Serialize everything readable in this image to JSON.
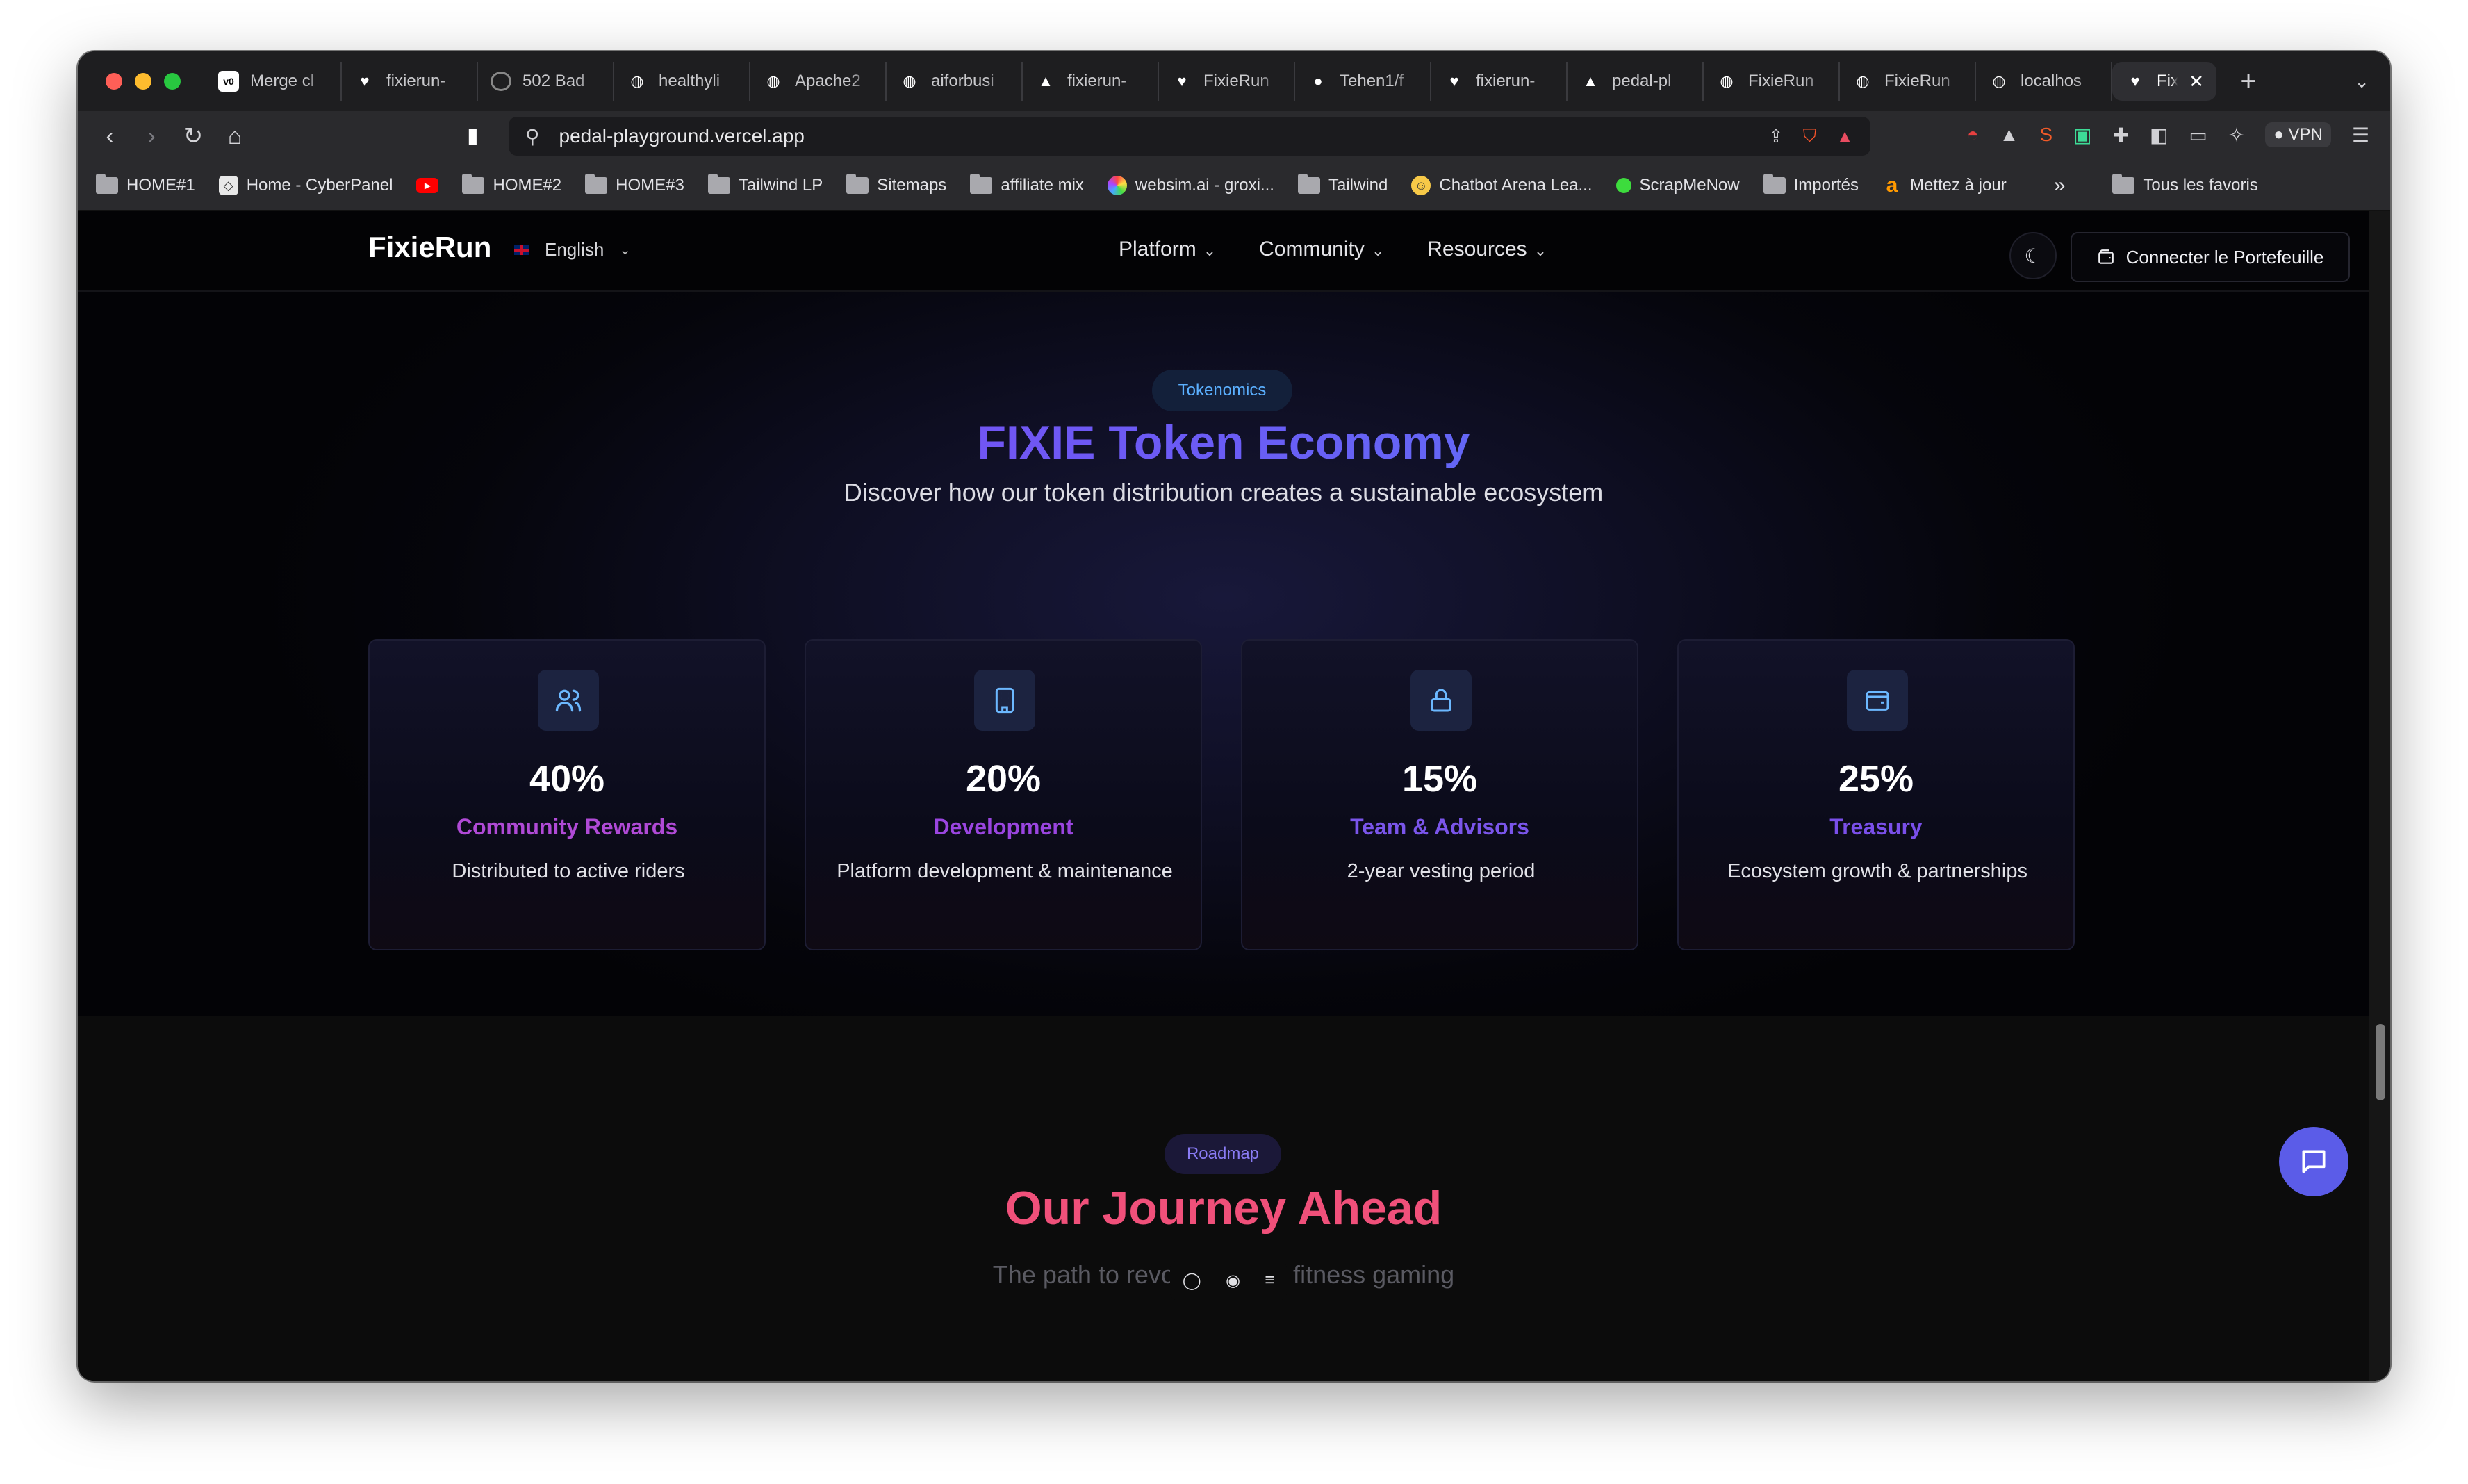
{
  "colors": {
    "traffic_close": "#ff5f57",
    "traffic_min": "#febc2e",
    "traffic_max": "#28c840",
    "accent_purple": "#8a3ff0",
    "accent_blue": "#4f8cf7",
    "road_pink": "#f0507a",
    "chat_button": "#5b5ce8"
  },
  "browser": {
    "tabs": [
      {
        "label": "Merge cl",
        "icon": "v0-icon"
      },
      {
        "label": "fixierun-",
        "icon": "heart-icon"
      },
      {
        "label": "502 Bad",
        "icon": "loading-icon"
      },
      {
        "label": "healthyli",
        "icon": "globe-icon"
      },
      {
        "label": "Apache2",
        "icon": "globe-icon"
      },
      {
        "label": "aiforbusi",
        "icon": "globe-icon"
      },
      {
        "label": "fixierun-",
        "icon": "vercel-icon"
      },
      {
        "label": "FixieRun",
        "icon": "heart-icon"
      },
      {
        "label": "Tehen1/f",
        "icon": "github-icon"
      },
      {
        "label": "fixierun-",
        "icon": "heart-icon"
      },
      {
        "label": "pedal-pl",
        "icon": "vercel-icon"
      },
      {
        "label": "FixieRun",
        "icon": "globe-icon"
      },
      {
        "label": "FixieRun",
        "icon": "globe-icon"
      },
      {
        "label": "localhos",
        "icon": "globe-icon"
      }
    ],
    "active_tab": {
      "label": "Fixie",
      "icon": "heart-icon"
    },
    "new_tab_label": "+",
    "url": "pedal-playground.vercel.app",
    "vpn_label": "VPN",
    "bookmarks": [
      {
        "label": "HOME#1",
        "type": "folder"
      },
      {
        "label": "Home - CyberPanel",
        "type": "site"
      },
      {
        "label": "",
        "type": "youtube"
      },
      {
        "label": "HOME#2",
        "type": "folder"
      },
      {
        "label": "HOME#3",
        "type": "folder"
      },
      {
        "label": "Tailwind LP",
        "type": "folder"
      },
      {
        "label": "Sitemaps",
        "type": "folder"
      },
      {
        "label": "affiliate mix",
        "type": "folder"
      },
      {
        "label": "websim.ai - groxi...",
        "type": "site"
      },
      {
        "label": "Tailwind",
        "type": "folder"
      },
      {
        "label": "Chatbot Arena Lea...",
        "type": "site"
      },
      {
        "label": "ScrapMeNow",
        "type": "site"
      },
      {
        "label": "Importés",
        "type": "folder"
      },
      {
        "label": "Mettez à jour",
        "type": "site"
      }
    ],
    "bookmarks_more": "»",
    "all_bookmarks": "Tous les favoris"
  },
  "site": {
    "logo": "FixieRun",
    "language": "English",
    "nav": [
      "Platform",
      "Community",
      "Resources"
    ],
    "wallet_button": "Connecter le Portefeuille",
    "tokenomics": {
      "badge": "Tokenomics",
      "title_part1": "FIXIE",
      "title_part2": "Token Economy",
      "subtitle": "Discover how our token distribution creates a sustainable ecosystem",
      "cards": [
        {
          "percent": "40%",
          "label": "Community Rewards",
          "desc": "Distributed to active riders",
          "icon": "users-icon",
          "color": "#b04ad6"
        },
        {
          "percent": "20%",
          "label": "Development",
          "desc": "Platform development & maintenance",
          "icon": "building-icon",
          "color": "#9a45e0"
        },
        {
          "percent": "15%",
          "label": "Team & Advisors",
          "desc": "2-year vesting period",
          "icon": "lock-icon",
          "color": "#7a55ea"
        },
        {
          "percent": "25%",
          "label": "Treasury",
          "desc": "Ecosystem growth & partnerships",
          "icon": "wallet-icon",
          "color": "#7a4fea"
        }
      ]
    },
    "roadmap": {
      "badge": "Roadmap",
      "title": "Our Journey Ahead",
      "subtitle": "The path to revolutionizing fitness gaming"
    }
  }
}
